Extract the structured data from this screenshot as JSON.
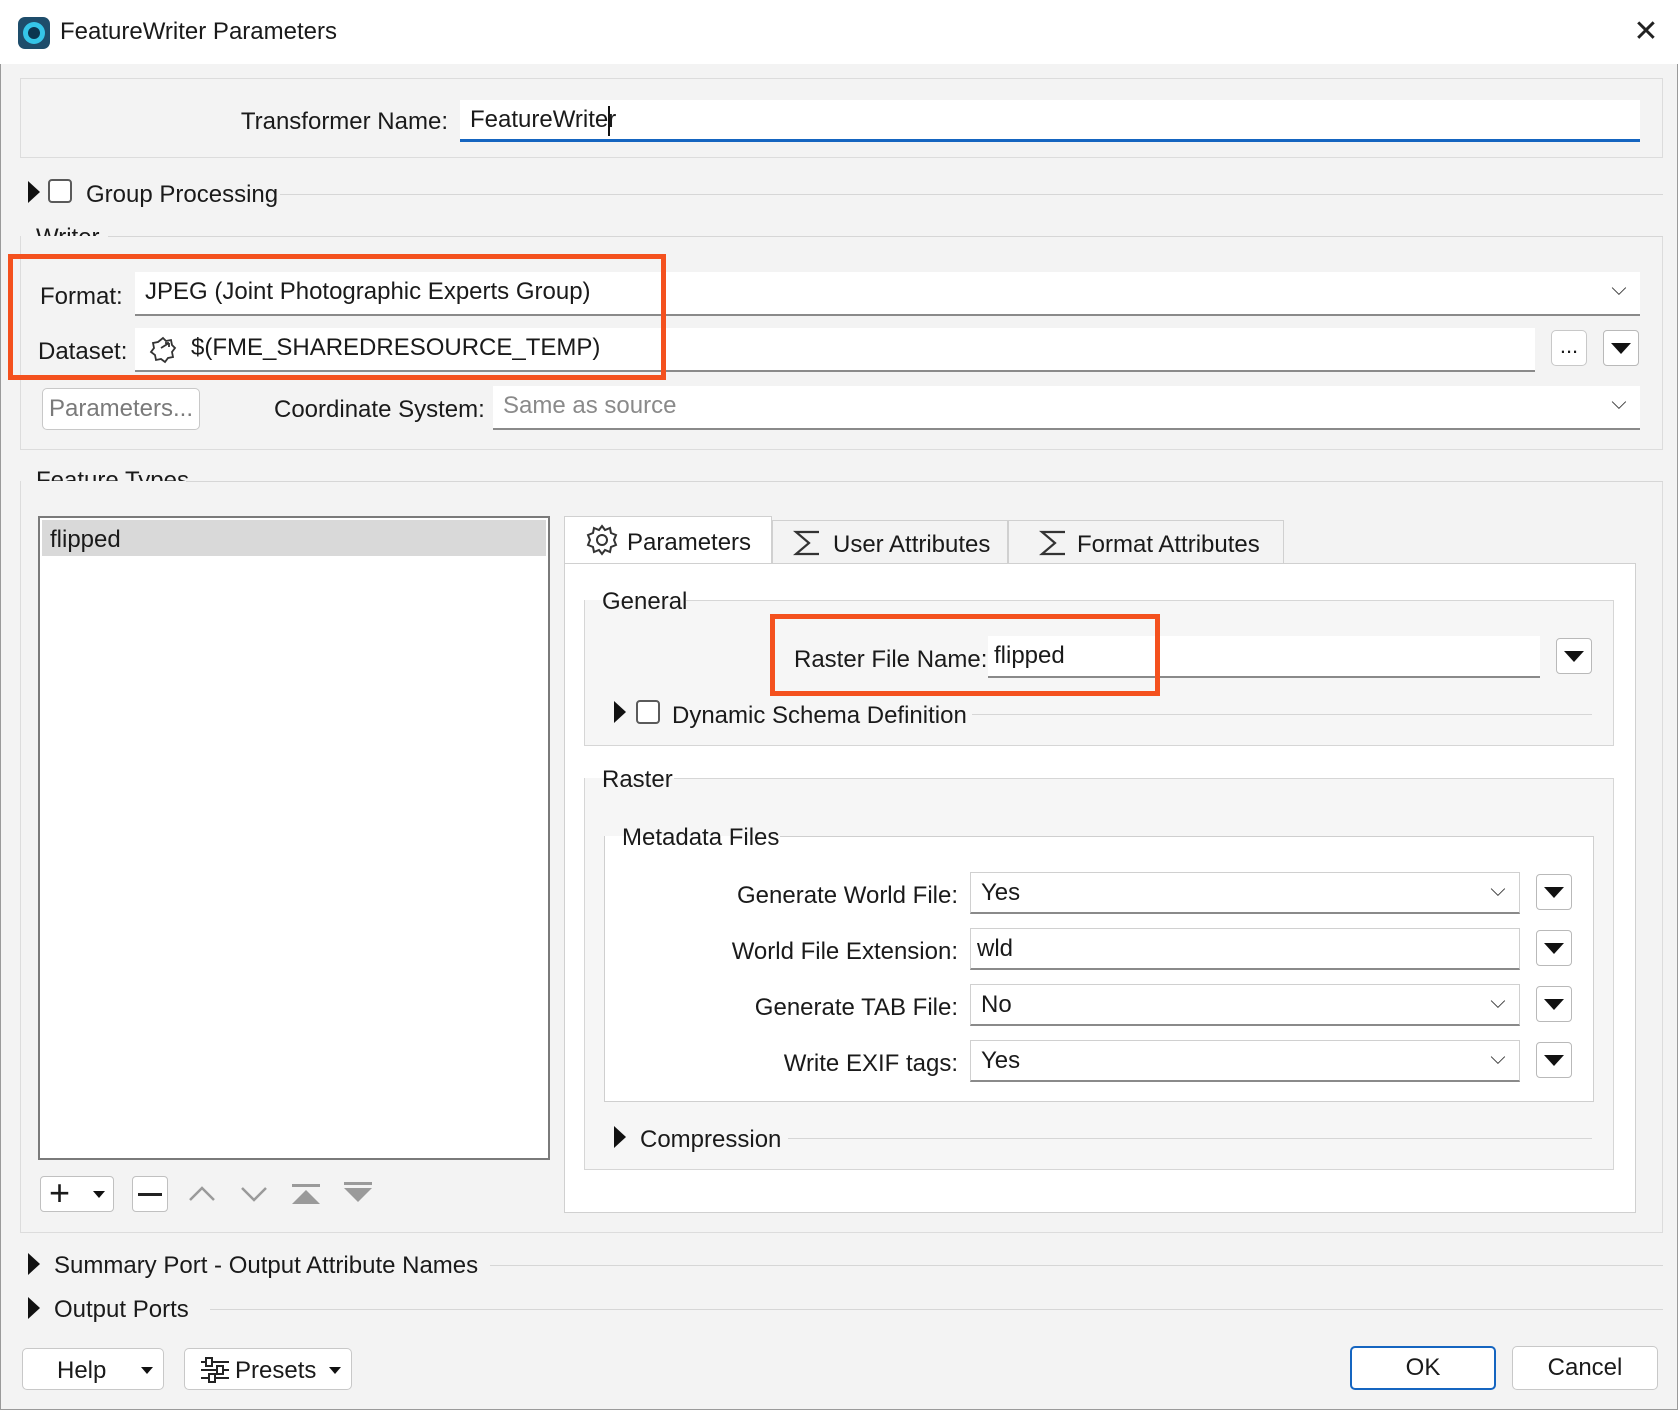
{
  "window": {
    "title": "FeatureWriter Parameters",
    "close_glyph": "✕"
  },
  "transformer": {
    "label": "Transformer Name:",
    "value": "FeatureWriter"
  },
  "group_processing": {
    "label": "Group Processing"
  },
  "writer": {
    "legend": "Writer",
    "format_label": "Format:",
    "format_value": "JPEG (Joint Photographic Experts Group)",
    "dataset_label": "Dataset:",
    "dataset_value": "$(FME_SHAREDRESOURCE_TEMP)",
    "browse_label": "...",
    "parameters_button": "Parameters...",
    "coord_label": "Coordinate System:",
    "coord_placeholder": "Same as source"
  },
  "feature_types": {
    "legend": "Feature Types",
    "items": [
      "flipped"
    ]
  },
  "tabs": [
    {
      "label": "Parameters",
      "icon": "gear-icon"
    },
    {
      "label": "User Attributes",
      "icon": "sigma-icon"
    },
    {
      "label": "Format Attributes",
      "icon": "sigma-icon"
    }
  ],
  "general": {
    "legend": "General",
    "raster_file_name_label": "Raster File Name:",
    "raster_file_name_value": "flipped",
    "dynamic_schema_label": "Dynamic Schema Definition"
  },
  "raster": {
    "legend": "Raster",
    "metadata_legend": "Metadata Files",
    "generate_world_file_label": "Generate World File:",
    "generate_world_file_value": "Yes",
    "world_file_ext_label": "World File Extension:",
    "world_file_ext_value": "wld",
    "generate_tab_label": "Generate TAB File:",
    "generate_tab_value": "No",
    "write_exif_label": "Write EXIF tags:",
    "write_exif_value": "Yes",
    "compression_label": "Compression"
  },
  "sections": {
    "summary_port": "Summary Port - Output Attribute Names",
    "output_ports": "Output Ports"
  },
  "footer": {
    "help": "Help",
    "presets": "Presets",
    "ok": "OK",
    "cancel": "Cancel"
  },
  "colors": {
    "highlight": "#f4511e",
    "accent": "#1565c0"
  }
}
